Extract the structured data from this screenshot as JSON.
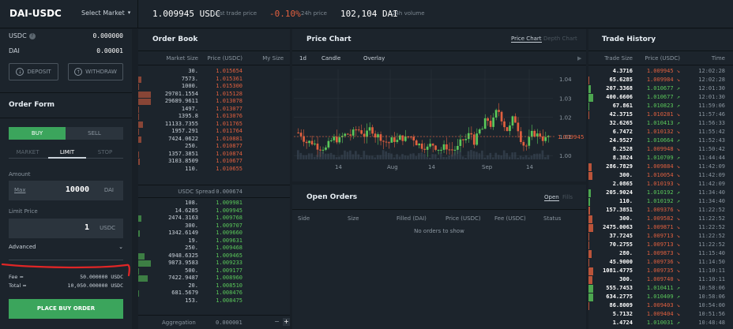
{
  "pair": "DAI-USDC",
  "select_market": "Select Market",
  "ticker": {
    "last_price": "1.009945",
    "last_price_unit": "USDC",
    "last_price_label": "Last trade price",
    "change": "-0.10%",
    "change_label": "24h price",
    "volume": "102,104",
    "volume_unit": "DAI",
    "volume_label": "24h volume"
  },
  "balances": [
    {
      "token": "USDC",
      "value": "0.000000"
    },
    {
      "token": "DAI",
      "value": "0.00001"
    }
  ],
  "deposit_label": "DEPOSIT",
  "withdraw_label": "WITHDRAW",
  "order_form": {
    "title": "Order Form",
    "buy": "BUY",
    "sell": "SELL",
    "market": "MARKET",
    "limit": "LIMIT",
    "stop": "STOP",
    "amount_label": "Amount",
    "max": "Max",
    "amount": "10000",
    "amount_unit": "DAI",
    "limit_label": "Limit Price",
    "limit_value": "1",
    "limit_unit": "USDC",
    "advanced": "Advanced",
    "fee_label": "Fee ≈",
    "fee_value": "50.000000 USDC",
    "total_label": "Total ≈",
    "total_value": "10,050.000000 USDC",
    "place": "PLACE BUY ORDER"
  },
  "order_book": {
    "title": "Order Book",
    "cols": [
      "Market Size",
      "Price (USDC)",
      "My Size"
    ],
    "asks": [
      [
        "30.",
        "1.015654"
      ],
      [
        "7573.",
        "1.015361"
      ],
      [
        "1000.",
        "1.015300"
      ],
      [
        "29701.1554",
        "1.015128"
      ],
      [
        "29689.9611",
        "1.013078"
      ],
      [
        "1497.",
        "1.013077"
      ],
      [
        "1395.8",
        "1.013076"
      ],
      [
        "11133.7355",
        "1.011765"
      ],
      [
        "1957.291",
        "1.011764"
      ],
      [
        "7424.0622",
        "1.010881"
      ],
      [
        "250.",
        "1.010877"
      ],
      [
        "1357.3851",
        "1.010874"
      ],
      [
        "3103.8509",
        "1.010677"
      ],
      [
        "110.",
        "1.010655"
      ]
    ],
    "spread_label": "USDC Spread",
    "spread": "0.000674",
    "bids": [
      [
        "108.",
        "1.009981"
      ],
      [
        "14.6285",
        "1.009945"
      ],
      [
        "2474.3163",
        "1.009768"
      ],
      [
        "300.",
        "1.009707"
      ],
      [
        "1342.6149",
        "1.009660"
      ],
      [
        "19.",
        "1.009631"
      ],
      [
        "250.",
        "1.009468"
      ],
      [
        "4948.6325",
        "1.009465"
      ],
      [
        "9873.9583",
        "1.009233"
      ],
      [
        "500.",
        "1.009177"
      ],
      [
        "7422.9487",
        "1.008960"
      ],
      [
        "20.",
        "1.008510"
      ],
      [
        "681.5679",
        "1.008476"
      ],
      [
        "153.",
        "1.008475"
      ]
    ],
    "aggregation_label": "Aggregation",
    "aggregation": "0.000001",
    "minus": "−",
    "plus": "+"
  },
  "chart": {
    "title": "Price Chart",
    "tab1": "Price Chart",
    "tab2": "Depth Chart",
    "interval": "1d",
    "type": "Candle",
    "overlay": "Overlay",
    "play": "▶",
    "y_labels": [
      "1.04",
      "1.03",
      "1.02",
      "1.01",
      "1.00"
    ],
    "x_labels": [
      "14",
      "Aug",
      "14",
      "Sep",
      "14"
    ],
    "last": "1.009945"
  },
  "open_orders": {
    "title": "Open Orders",
    "tab1": "Open",
    "tab2": "Fills",
    "cols": [
      "Side",
      "Size",
      "Filled (DAI)",
      "Price (USDC)",
      "Fee (USDC)",
      "Status"
    ],
    "empty": "No orders to show"
  },
  "trade_history": {
    "title": "Trade History",
    "cols": [
      "Trade Size",
      "Price (USDC)",
      "Time"
    ],
    "rows": [
      [
        "4.3716",
        "1.009945",
        "↘",
        "12:02:28",
        "red"
      ],
      [
        "65.6285",
        "1.009984",
        "↘",
        "12:02:28",
        "red"
      ],
      [
        "207.3368",
        "1.010677",
        "↗",
        "12:01:30",
        "green"
      ],
      [
        "400.6606",
        "1.010677",
        "↗",
        "12:01:30",
        "green"
      ],
      [
        "67.861",
        "1.010823",
        "↗",
        "11:59:06",
        "green"
      ],
      [
        "42.3715",
        "1.010281",
        "↘",
        "11:57:46",
        "red"
      ],
      [
        "32.6265",
        "1.010413",
        "↗",
        "11:56:33",
        "green"
      ],
      [
        "6.7472",
        "1.010132",
        "↘",
        "11:55:42",
        "red"
      ],
      [
        "24.9527",
        "1.010664",
        "↗",
        "11:52:43",
        "green"
      ],
      [
        "8.2528",
        "1.009948",
        "↘",
        "11:50:42",
        "red"
      ],
      [
        "8.3824",
        "1.010709",
        "↗",
        "11:44:44",
        "green"
      ],
      [
        "286.7829",
        "1.009884",
        "↘",
        "11:42:09",
        "red"
      ],
      [
        "300.",
        "1.010054",
        "↘",
        "11:42:09",
        "red"
      ],
      [
        "2.0865",
        "1.010193",
        "↘",
        "11:42:09",
        "red"
      ],
      [
        "205.9024",
        "1.010192",
        "↗",
        "11:34:40",
        "green"
      ],
      [
        "110.",
        "1.010192",
        "↗",
        "11:34:40",
        "green"
      ],
      [
        "157.3851",
        "1.009376",
        "↘",
        "11:22:52",
        "red"
      ],
      [
        "300.",
        "1.009582",
        "↘",
        "11:22:52",
        "red"
      ],
      [
        "2475.0063",
        "1.009871",
        "↘",
        "11:22:52",
        "red"
      ],
      [
        "37.7245",
        "1.009713",
        "↘",
        "11:22:52",
        "red"
      ],
      [
        "70.2755",
        "1.009713",
        "↘",
        "11:22:52",
        "red"
      ],
      [
        "280.",
        "1.009873",
        "↘",
        "11:15:40",
        "red"
      ],
      [
        "45.9000",
        "1.009736",
        "↘",
        "11:14:50",
        "red"
      ],
      [
        "1081.4775",
        "1.009735",
        "↘",
        "11:10:11",
        "red"
      ],
      [
        "300.",
        "1.009740",
        "↘",
        "11:10:11",
        "red"
      ],
      [
        "555.7453",
        "1.010411",
        "↗",
        "10:58:06",
        "green"
      ],
      [
        "634.2775",
        "1.010409",
        "↗",
        "10:58:06",
        "green"
      ],
      [
        "86.8009",
        "1.009403",
        "↘",
        "10:54:00",
        "red"
      ],
      [
        "5.7132",
        "1.009404",
        "↘",
        "10:51:56",
        "red"
      ],
      [
        "1.4724",
        "1.010031",
        "↗",
        "10:48:48",
        "green"
      ]
    ]
  },
  "colors": {
    "green": "#5ac85a",
    "red": "#e2603f",
    "buy": "#3ba55c",
    "annotation": "#e02626"
  }
}
